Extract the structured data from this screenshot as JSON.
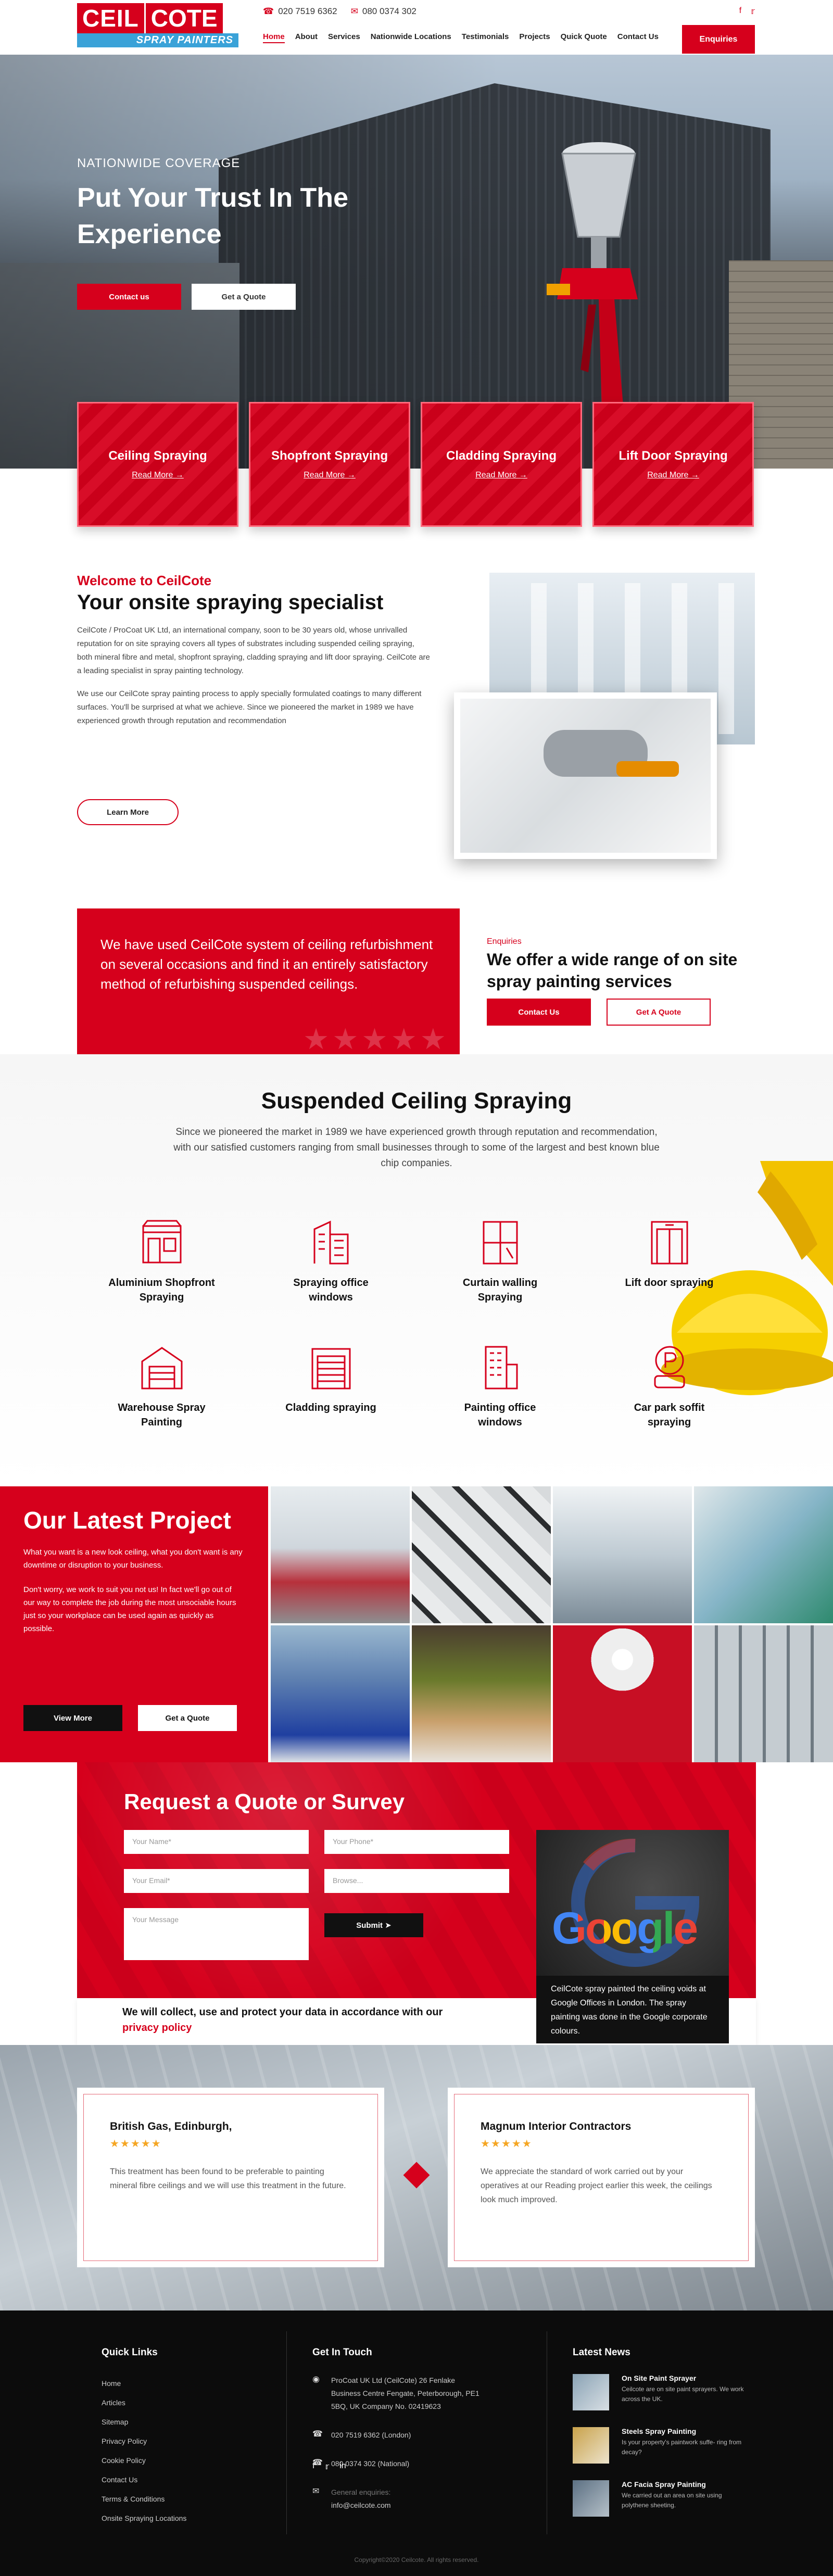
{
  "header": {
    "logo_word1": "CEIL",
    "logo_word2": "COTE",
    "logo_tagline": "SPRAY PAINTERS",
    "phone_1": "020 7519 6362",
    "phone_2": "080 0374 302",
    "social": [
      "facebook-icon",
      "twitter-icon"
    ],
    "nav": [
      "Home",
      "About",
      "Services",
      "Nationwide Locations",
      "Testimonials",
      "Projects",
      "Quick Quote",
      "Contact Us"
    ],
    "enquiries_label": "Enquiries"
  },
  "hero": {
    "eyebrow": "NATIONWIDE COVERAGE",
    "title": "Put Your Trust In The Experience",
    "btn_contact": "Contact us",
    "btn_quote": "Get a Quote"
  },
  "services": [
    {
      "title": "Ceiling Spraying",
      "link": "Read More →"
    },
    {
      "title": "Shopfront Spraying",
      "link": "Read More →"
    },
    {
      "title": "Cladding Spraying",
      "link": "Read More →"
    },
    {
      "title": "Lift Door Spraying",
      "link": "Read More →"
    }
  ],
  "welcome": {
    "eyebrow": "Welcome to CeilCote",
    "title": "Your onsite spraying specialist",
    "para1": "CeilCote / ProCoat UK Ltd, an international company, soon to be 30 years old, whose unrivalled reputation for on site spraying covers all types of substrates including suspended ceiling spraying, both mineral fibre and metal, shopfront spraying, cladding spraying and lift door spraying. CeilCote are a leading specialist in spray painting technology.",
    "para2": "We use our CeilCote spray painting process to apply specially formulated coatings to many different surfaces. You'll be surprised at what we achieve. Since we pioneered the market in 1989 we have experienced growth through reputation and recommendation",
    "learn_more": "Learn More"
  },
  "testimonial_band": {
    "quote": "We have used CeilCote system of ceiling refurbishment on several occasions and find it an entirely satisfactory method of refurbishing suspended ceilings.",
    "enq_eyebrow": "Enquiries",
    "enq_title": "We offer a wide range of on site spray painting services",
    "btn_contact": "Contact Us",
    "btn_quote": "Get A Quote"
  },
  "suspended": {
    "title": "Suspended Ceiling Spraying",
    "text": "Since we pioneered the market in 1989 we have experienced growth through reputation and recommendation, with our satisfied customers ranging from small businesses through to some of the largest and best known blue chip companies.",
    "features": [
      {
        "label": "Aluminium Shopfront Spraying",
        "icon": "shopfront-icon"
      },
      {
        "label": "Spraying office windows",
        "icon": "office-building-icon"
      },
      {
        "label": "Curtain walling Spraying",
        "icon": "window-icon"
      },
      {
        "label": "Lift door spraying",
        "icon": "lift-door-icon"
      },
      {
        "label": "Warehouse Spray Painting",
        "icon": "warehouse-icon"
      },
      {
        "label": "Cladding spraying",
        "icon": "garage-icon"
      },
      {
        "label": "Painting office windows",
        "icon": "tower-icon"
      },
      {
        "label": "Car park soffit spraying",
        "icon": "parking-icon"
      }
    ]
  },
  "project": {
    "title": "Our Latest Project",
    "para1": "What you want is a new look ceiling, what you don't want is any downtime or disruption to your business.",
    "para2": "Don't worry, we work to suit you not us! In fact we'll go out of our way to complete the job during the most unsociable hours just so your workplace can be used again as quickly as possible.",
    "btn_view": "View More",
    "btn_quote": "Get a Quote"
  },
  "quote": {
    "title": "Request a Quote or Survey",
    "name_ph": "Your Name*",
    "phone_ph": "Your Phone*",
    "email_ph": "Your Email*",
    "browse_ph": "Browse...",
    "message_ph": "Your Message",
    "submit": "Submit",
    "privacy_text": "We will collect, use and protect your data in accordance with our",
    "privacy_link": "privacy policy",
    "google_word": "Google",
    "google_caption": "CeilCote spray painted the ceiling voids at Google Offices in London. The spray painting was done in the Google corporate colours."
  },
  "reviews": [
    {
      "name": "British Gas, Edinburgh,",
      "stars": "★★★★★",
      "text": "This treatment has been found to be preferable to painting mineral fibre ceilings and we will use this treatment in the future."
    },
    {
      "name": "Magnum Interior Contractors",
      "stars": "★★★★★",
      "text": "We appreciate the standard of work carried out by your operatives at our Reading project earlier this week, the ceilings look much improved."
    }
  ],
  "footer": {
    "quick_links_title": "Quick Links",
    "quick_links": [
      "Home",
      "Articles",
      "Sitemap",
      "Privacy Policy",
      "Cookie Policy",
      "Contact Us",
      "Terms & Conditions",
      "Onsite Spraying Locations"
    ],
    "get_in_touch_title": "Get In Touch",
    "address": "ProCoat UK Ltd (CeilCote) 26 Fenlake Business Centre Fengate, Peterborough, PE1 5BQ, UK Company No. 02419623",
    "phone_london": "020 7519 6362 (London)",
    "phone_national": "080 0374 302 (National)",
    "enquiries_label": "General enquiries:",
    "email": "info@ceilcote.com",
    "news_title": "Latest News",
    "news": [
      {
        "title": "On Site Paint Sprayer",
        "text": "Ceilcote are on site paint sprayers. We work across the UK."
      },
      {
        "title": "Steels Spray Painting",
        "text": "Is your property's paintwork suffe- ring from decay?"
      },
      {
        "title": "AC Facia Spray Painting",
        "text": "We carried out an area on site using polythene sheeting."
      }
    ],
    "copyright": "Copyright©2020 Ceilcote. All rights reserved."
  },
  "colors": {
    "brand_red": "#d6001c",
    "brand_blue": "#3aa2d8",
    "footer_bg": "#0c0c0c"
  }
}
